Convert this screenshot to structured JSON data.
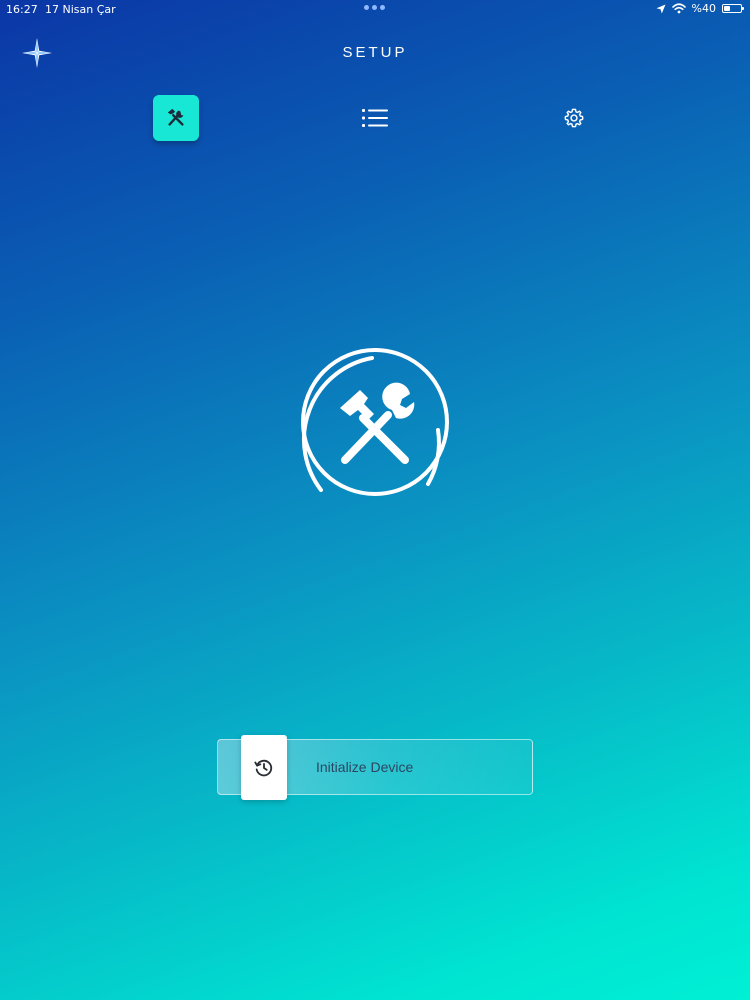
{
  "status_bar": {
    "time": "16:27",
    "date": "17 Nisan Çar",
    "battery": "%40",
    "battery_level": 0.4,
    "icons": [
      "location-icon",
      "wifi-icon",
      "battery-icon"
    ]
  },
  "header": {
    "title": "SETUP",
    "logo_icon": "sparkle-logo-icon"
  },
  "nav": {
    "items": [
      {
        "icon": "tools-icon",
        "active": true
      },
      {
        "icon": "list-icon",
        "active": false
      },
      {
        "icon": "gear-icon",
        "active": false
      }
    ],
    "active_color": "#19e7d6"
  },
  "hero": {
    "icon": "tools-circle-icon"
  },
  "action": {
    "label": "Initialize Device",
    "handle_icon": "history-icon"
  },
  "colors": {
    "gradient_top": "#0b36a6",
    "gradient_bottom": "#00f0d4",
    "label_text": "#2b4660"
  }
}
